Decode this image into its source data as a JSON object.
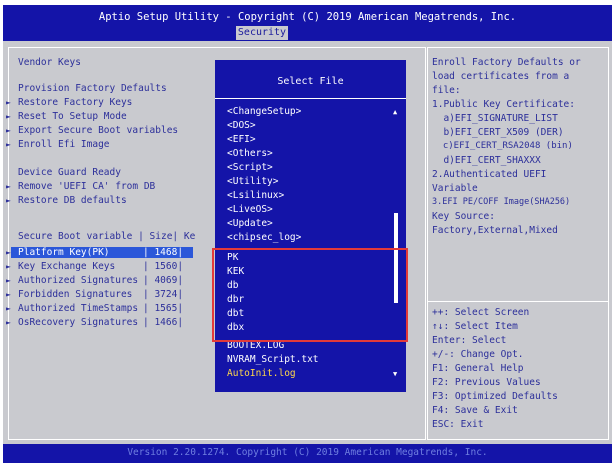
{
  "app_title": "Aptio Setup Utility - Copyright (C) 2019 American Megatrends, Inc.",
  "active_tab": "Security",
  "version_text": "Version 2.20.1274. Copyright (C) 2019 American Megatrends, Inc.",
  "main": {
    "vendor_keys": "Vendor Keys",
    "provision_factory_defaults": "Provision Factory Defaults",
    "items_a": [
      "Restore Factory Keys",
      "Reset To Setup Mode",
      "Export Secure Boot variables",
      "Enroll Efi Image"
    ],
    "device_guard_ready": "Device Guard Ready",
    "items_b": [
      "Remove 'UEFI CA' from DB",
      "Restore DB defaults"
    ],
    "table_header": "Secure Boot variable | Size| Ke",
    "rows": [
      {
        "name": "Platform Key(PK)",
        "size": "1468"
      },
      {
        "name": "Key Exchange Keys",
        "size": "1560"
      },
      {
        "name": "Authorized Signatures",
        "size": "4069"
      },
      {
        "name": "Forbidden  Signatures",
        "size": "3724"
      },
      {
        "name": "Authorized TimeStamps",
        "size": "1565"
      },
      {
        "name": "OsRecovery Signatures",
        "size": "1466"
      }
    ]
  },
  "popup": {
    "title": "Select File",
    "files": [
      "<ChangeSetup>",
      "<DOS>",
      "<EFI>",
      "<Others>",
      "<Script>",
      "<Utility>",
      "<Lsilinux>",
      "<LiveOS>",
      "<Update>",
      "<chipsec_log>",
      "PK",
      "KEK",
      "db",
      "dbr",
      "dbt",
      "dbx",
      "BOOTEX.LOG",
      "NVRAM_Script.txt",
      "AutoInit.log"
    ],
    "selected_index": 18
  },
  "help": {
    "lines": [
      "Enroll Factory Defaults or",
      "load certificates from a",
      "file:",
      "1.Public Key Certificate:",
      "  a)EFI_SIGNATURE_LIST",
      "  b)EFI_CERT_X509 (DER)",
      "  c)EFI_CERT_RSA2048 (bin)",
      "  d)EFI_CERT_SHAXXX",
      "2.Authenticated UEFI",
      "Variable",
      "3.EFI PE/COFF Image(SHA256)",
      "Key Source:",
      "Factory,External,Mixed"
    ],
    "keys": [
      "++: Select Screen",
      "↑↓: Select Item",
      "Enter: Select",
      "+/-: Change Opt.",
      "F1: General Help",
      "F2: Previous Values",
      "F3: Optimized Defaults",
      "F4: Save & Exit",
      "ESC: Exit"
    ]
  },
  "colors": {
    "bios_blue": "#1414a8",
    "panel_gray": "#c9cacf",
    "highlight": "#2b57d9",
    "selected_file": "#ffd84a",
    "annotation_red": "#e23a3a"
  }
}
